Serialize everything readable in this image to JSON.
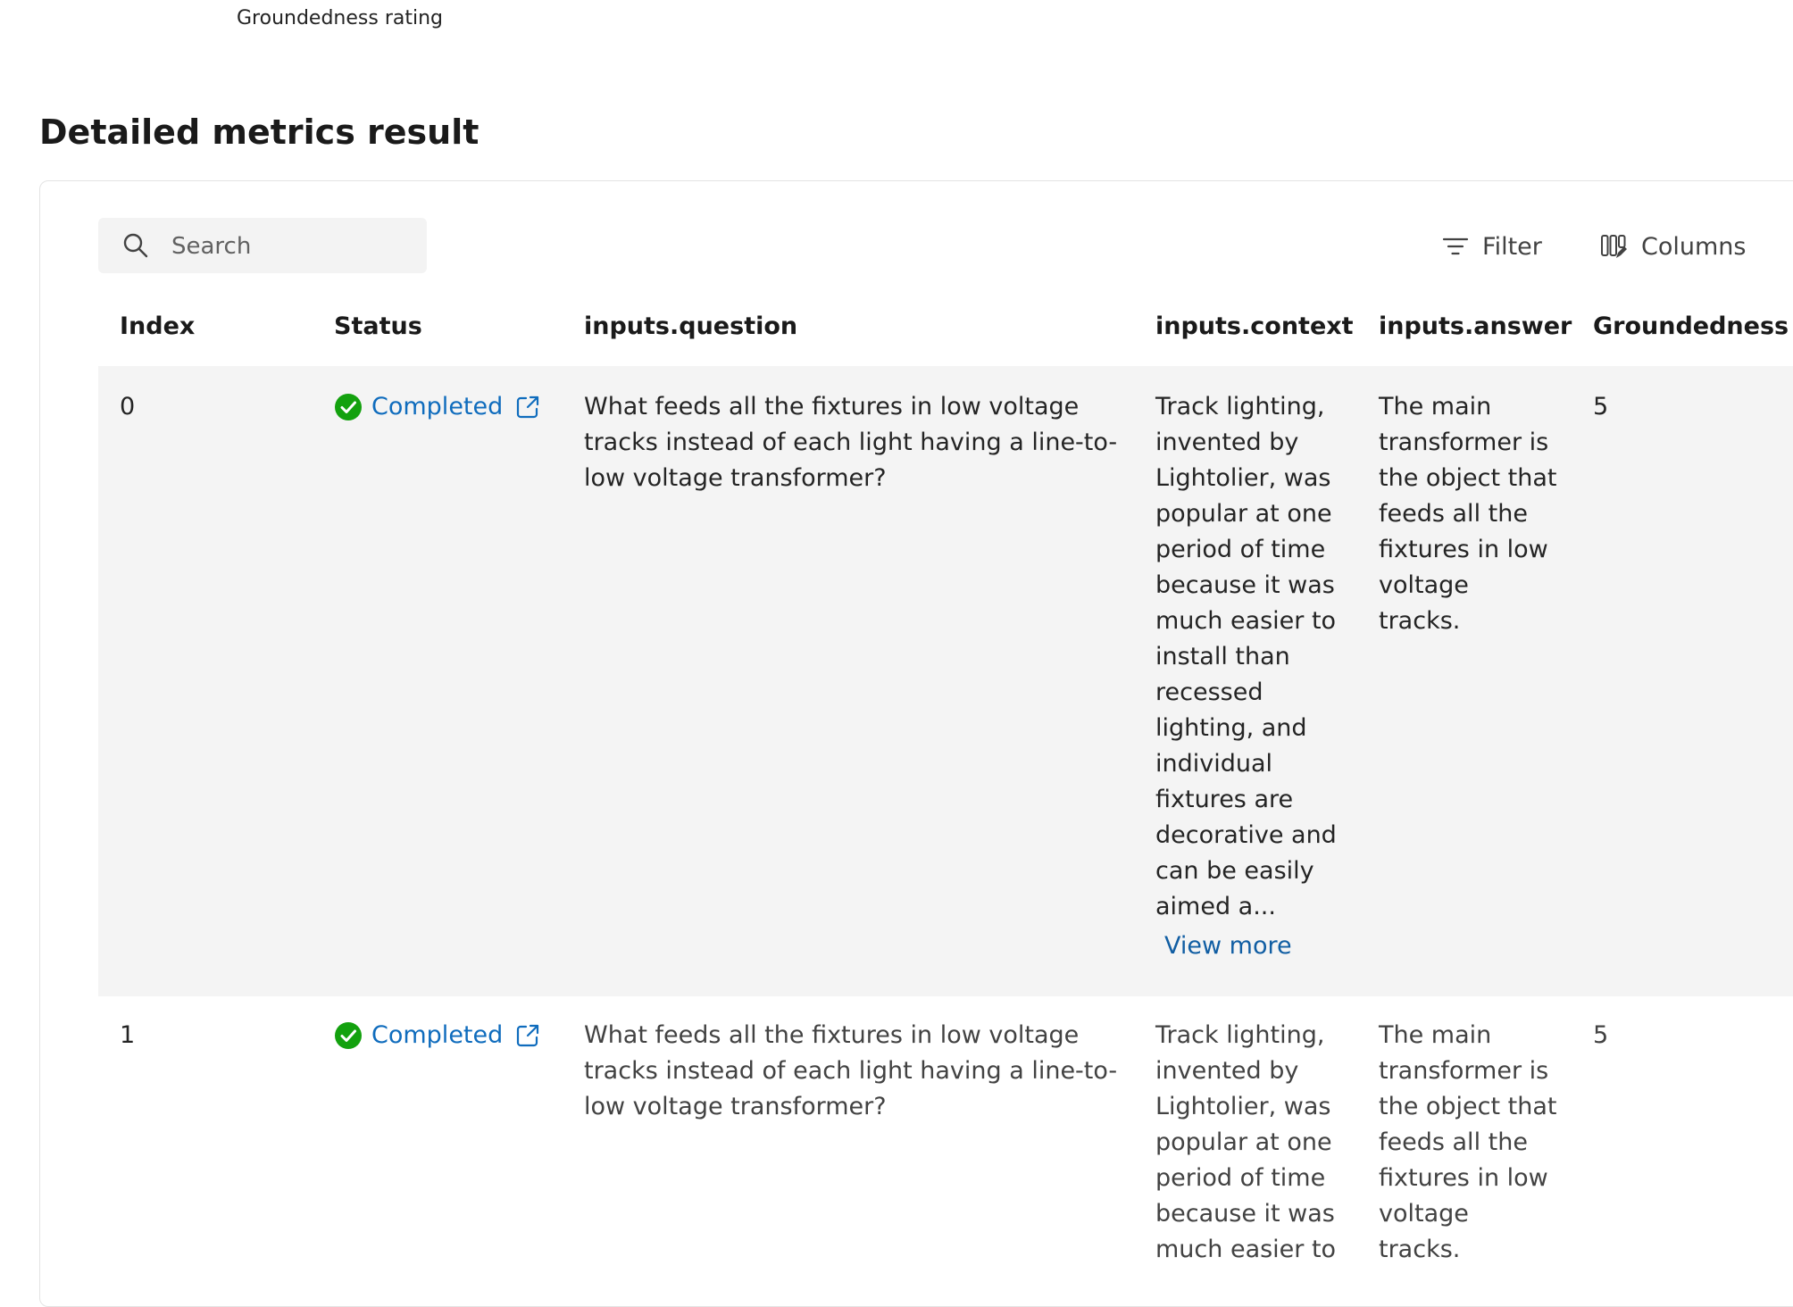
{
  "top_caption": "Groundedness rating",
  "section_title": "Detailed metrics result",
  "toolbar": {
    "search_placeholder": "Search",
    "filter_label": "Filter",
    "columns_label": "Columns"
  },
  "table": {
    "headers": {
      "index": "Index",
      "status": "Status",
      "question": "inputs.question",
      "context": "inputs.context",
      "answer": "inputs.answer",
      "groundedness": "Groundedness"
    },
    "rows": [
      {
        "index": "0",
        "status": "Completed",
        "question": "What feeds all the fixtures in low voltage tracks instead of each light having a line-to-low voltage transformer?",
        "context": "Track lighting, invented by Lightolier, was popular at one period of time because it was much easier to install than recessed lighting, and individual fixtures are decorative and can be easily aimed a...",
        "answer": "The main transformer is the object that feeds all the fixtures in low voltage tracks.",
        "groundedness": "5",
        "view_more": "View more"
      },
      {
        "index": "1",
        "status": "Completed",
        "question": "What feeds all the fixtures in low voltage tracks instead of each light having a line-to-low voltage transformer?",
        "context": "Track lighting, invented by Lightolier, was popular at one period of time because it was much easier to",
        "answer": "The main transformer is the object that feeds all the fixtures in low voltage tracks.",
        "groundedness": "5"
      }
    ]
  },
  "colors": {
    "accent_link": "#0f6cbd",
    "success": "#13a10e",
    "row_highlight": "#f4f4f4"
  },
  "icons": {
    "search": "search-icon",
    "filter": "filter-icon",
    "columns": "columns-icon",
    "status": "check-icon",
    "open": "external-link-icon"
  }
}
